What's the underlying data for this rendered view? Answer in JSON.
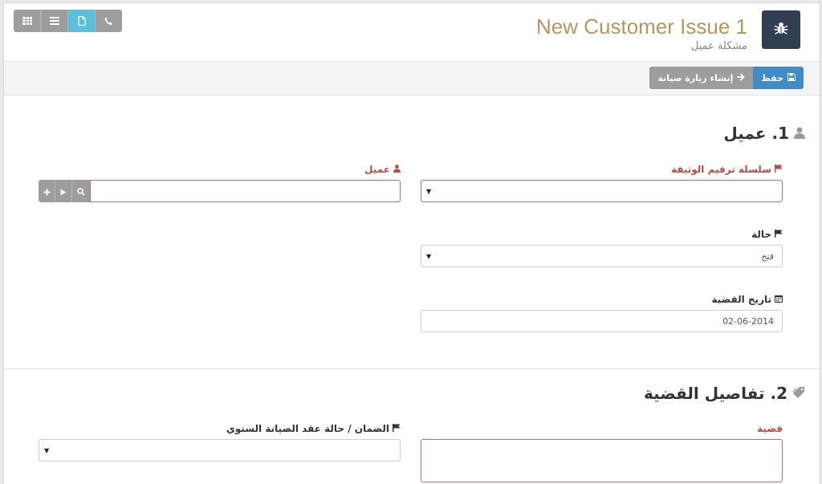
{
  "header": {
    "title": "New Customer Issue 1",
    "subtitle": "مشكلة عميل",
    "doc_icon": "bug-icon",
    "view_switcher": [
      {
        "icon": "table-icon",
        "active": false
      },
      {
        "icon": "list-icon",
        "active": false
      },
      {
        "icon": "file-icon",
        "active": true
      },
      {
        "icon": "phone-icon",
        "active": false
      }
    ]
  },
  "toolbar": {
    "save_label": "حفظ",
    "make_visit_label": "إنشاء زيارة صيانة"
  },
  "sections": {
    "customer": {
      "title": "1. عميل",
      "naming_series_label": "سلسلة ترقيم الوثيقة",
      "naming_series_value": "",
      "customer_label": "عميل",
      "customer_value": "",
      "status_label": "حالة",
      "status_value": "فتح",
      "issue_date_label": "تاريخ القضية",
      "issue_date_value": "02-06-2014"
    },
    "issue_details": {
      "title": "2. تفاصيل القضية",
      "complaint_label": "قضية",
      "complaint_value": "",
      "warranty_label": "الضمان / حالة عقد الصيانة السنوي",
      "warranty_value": ""
    }
  },
  "colors": {
    "title": "#b9955c",
    "primary": "#428bca",
    "info": "#5bc0de",
    "required": "#b94a48",
    "icon_bg": "#2f3e50"
  }
}
